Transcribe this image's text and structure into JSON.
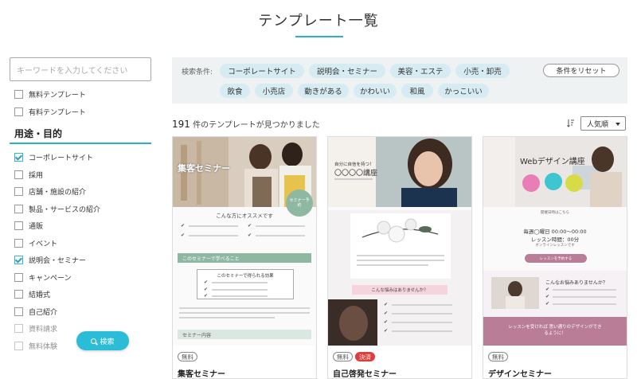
{
  "page": {
    "title": "テンプレート一覧"
  },
  "sidebar": {
    "search_placeholder": "キーワードを入力してください",
    "price_filters": [
      {
        "label": "無料テンプレート",
        "checked": false
      },
      {
        "label": "有料テンプレート",
        "checked": false
      }
    ],
    "section_title": "用途・目的",
    "purposes": [
      {
        "label": "コーポレートサイト",
        "checked": true
      },
      {
        "label": "採用",
        "checked": false
      },
      {
        "label": "店舗・施設の紹介",
        "checked": false
      },
      {
        "label": "製品・サービスの紹介",
        "checked": false
      },
      {
        "label": "通販",
        "checked": false
      },
      {
        "label": "イベント",
        "checked": false
      },
      {
        "label": "説明会・セミナー",
        "checked": true
      },
      {
        "label": "キャンペーン",
        "checked": false
      },
      {
        "label": "結婚式",
        "checked": false
      },
      {
        "label": "自己紹介",
        "checked": false
      },
      {
        "label": "資料請求",
        "checked": false
      },
      {
        "label": "無料体験",
        "checked": false
      }
    ],
    "search_button": "検索"
  },
  "filters": {
    "label": "検索条件:",
    "chips": [
      "コーポレートサイト",
      "説明会・セミナー",
      "美容・エステ",
      "小売・卸売",
      "飲食",
      "小売店",
      "動きがある",
      "かわいい",
      "和風",
      "かっこいい"
    ],
    "reset_label": "条件をリセット"
  },
  "results": {
    "count": "191",
    "count_suffix": "件のテンプレートが見つかりました",
    "sort_value": "人気順"
  },
  "cards": [
    {
      "name": "集客セミナー",
      "tags": [
        "無料"
      ],
      "thumb": {
        "hero_title": "集客セミナー",
        "badge": "セミナー予約",
        "recommend": "こんな方にオススメです",
        "band1": "このセミナーで学べること",
        "box_title": "このセミナーで得られる効果",
        "band2": "セミナー内容"
      }
    },
    {
      "name": "自己啓発セミナー",
      "tags": [
        "無料",
        "決済"
      ],
      "thumb": {
        "hero_line1": "自分に自信を持つ！",
        "hero_title": "〇〇〇〇講座",
        "ribbon": "こんな悩みはありませんか？"
      }
    },
    {
      "name": "デザインセミナー",
      "tags": [
        "無料"
      ],
      "thumb": {
        "hero_title": "Webデザイン講座",
        "info_label": "開催日時はこちら",
        "info_time": "毎週◯曜日 00:00〜00:00",
        "info_duration": "レッスン時間：00分",
        "info_note": "オンラインレッスンです",
        "cta": "レッスンを予約する",
        "worry_title": "こんなお悩みありませんか？",
        "bottom_band": "レッスンを受ければ 思い通りのデザインができるように！"
      }
    }
  ],
  "colors": {
    "accent": "#2ab0c9",
    "chip": "#d6ecf2",
    "paid": "#e03c3c",
    "filter_bg": "#eef2f3"
  }
}
